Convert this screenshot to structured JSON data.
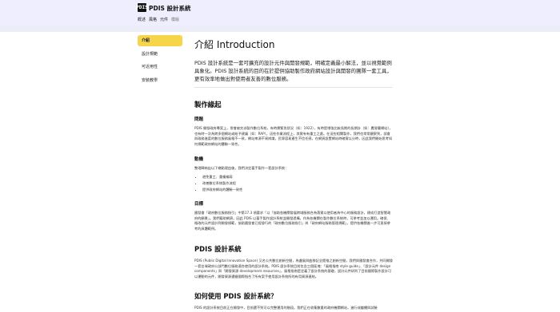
{
  "header": {
    "logo_text": "PDIS",
    "brand": "PDIS 設計系統",
    "nav": [
      "概述",
      "風格",
      "元件",
      "模版"
    ]
  },
  "sidebar": {
    "items": [
      "介紹",
      "設計規範",
      "可近用性",
      "安裝教學"
    ]
  },
  "main": {
    "title": "介紹 Introduction",
    "intro": "PDIS 設計系統是一套可擴充的設計元件與開發規範，明確定義最小解法，並以視覺範例具象化。PDIS 設計系統的目的在於提供協助製作政府網站設計與開發的團隊一套工具，更有效率地做出對使用者友善的數位服務。",
    "section1": {
      "heading": "製作緣起",
      "problem_heading": "問題",
      "problem_text": "PDIS 開發政府專案上，常會被交派製作數位系統，有時需緊急狀況（如：1922），有時是增強比較長期的長期計（如：農發署網站），也有時一次為跨多個網站或給予建議（如：RAP）。這些作業流程上，其實有有重工之處。在這些相關製作，我們也常常觀察到，部會與政務進度的數位服務風格不一致，網站來源不易辨識，民眾容易產生不信任感，在網頁設置網站時確實以分時，因此我們開始思考如何規範政府網站的體驗一致性。",
      "motive_heading": "動機",
      "motive_text": "整理歸納出以下幾點理由後，我們決定著手製作一套設計系統：",
      "motive_list": [
        "避免重工、重複編寫",
        "改善數位系統製作流程",
        "提供政府網站的體驗一致性"
      ],
      "goal_heading": "目標",
      "goal_text": "國發會「政府數位服務指引」中第17.3 項要求「以「協助各機關發展跨域服務合為落實以使用者為中心的服務設計，建成打造智慧政府的願景」。我們藉助網頁，因此 PDIS 以著手製作設計系統並開發過構，作為各機關在製作數位系統時，可參考並加以運用。確保、格改的元件設計到開發規範，協助國發會已經發行的「政府數位服務指引」與「政府網站服務管理規範」，提供各機關進一步可直接參考的具體範例。"
    },
    "section2": {
      "heading": "PDIS 設計系統",
      "text": "PDIS (Public Digital Innovation Space) 又名公共數位創新空間，為盧風與曲移記全館推之創新空間，我們與國發會合作，共同開發一套台灣政府公部門數位服務適合使用的設計系統。PDIS 設計系統目前包含三個區塊：「風格指南 style guide」、「設計元件 design components」與「開發資源 development resources」，風格指南是定義了設計系統的基礎，設計元件研判了目前國際製作設計可以運動的元件，開發資源遵循國際指合了所有案手使用設計系統所的有用資源連結。"
    },
    "section3": {
      "heading": "如何使用 PDIS 設計系統？",
      "text": "PDIS 的設計系統目前正在開發中，目前還不到可以完整運用的階段。我們正在收集數量的政府機關網站，進行成繼續與試驗"
    }
  }
}
